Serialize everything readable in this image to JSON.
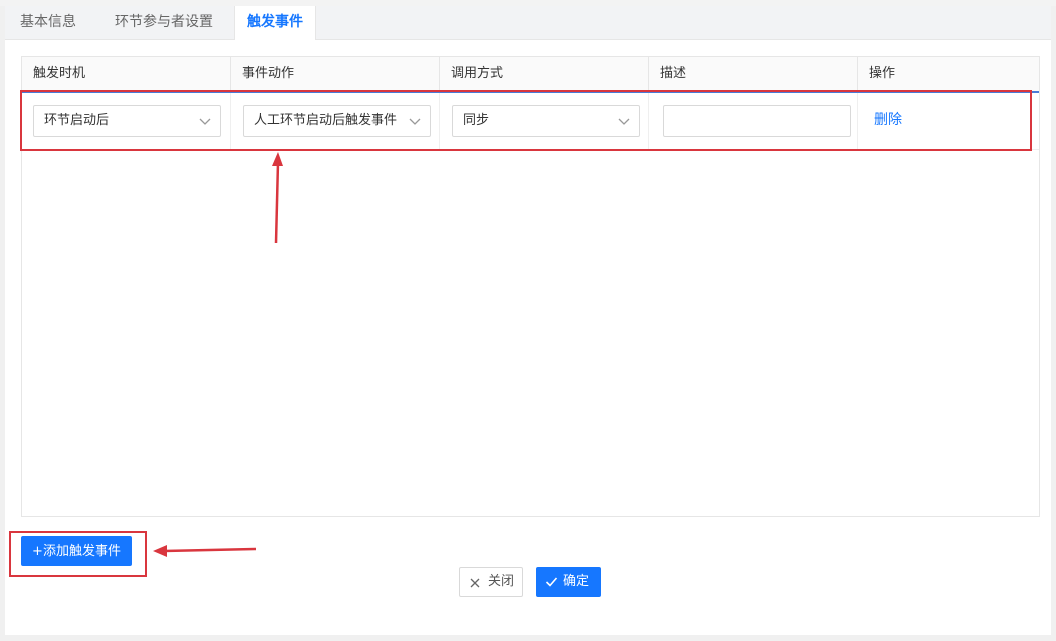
{
  "tabs": [
    {
      "label": "基本信息",
      "active": false
    },
    {
      "label": "环节参与者设置",
      "active": false
    },
    {
      "label": "触发事件",
      "active": true
    }
  ],
  "table": {
    "headers": [
      "触发时机",
      "事件动作",
      "调用方式",
      "描述",
      "操作"
    ],
    "rows": [
      {
        "trigger_time": "环节启动后",
        "event_action": "人工环节启动后触发事件",
        "call_mode": "同步",
        "description": "",
        "delete_label": "删除"
      }
    ]
  },
  "buttons": {
    "add_trigger": "+添加触发事件",
    "close": "关闭",
    "confirm": "确定"
  },
  "icons": {
    "dropdown": "chevron-down-icon",
    "close": "close-icon",
    "confirm": "check-icon"
  },
  "colors": {
    "primary": "#1677ff",
    "annotation": "#d9363e"
  }
}
